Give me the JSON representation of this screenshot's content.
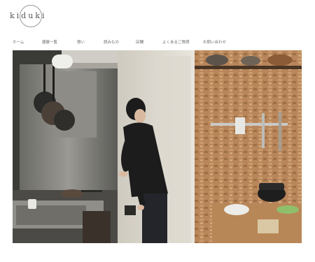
{
  "logo": {
    "text": "kiduki"
  },
  "nav": {
    "items": [
      {
        "label": "ホーム"
      },
      {
        "label": "器展一覧"
      },
      {
        "label": "想い"
      },
      {
        "label": "読みもの"
      },
      {
        "label": "店舗"
      },
      {
        "label": "よくあるご質問"
      },
      {
        "label": "お問い合わせ"
      }
    ]
  },
  "hero": {
    "icon": "kitchen-photo"
  }
}
